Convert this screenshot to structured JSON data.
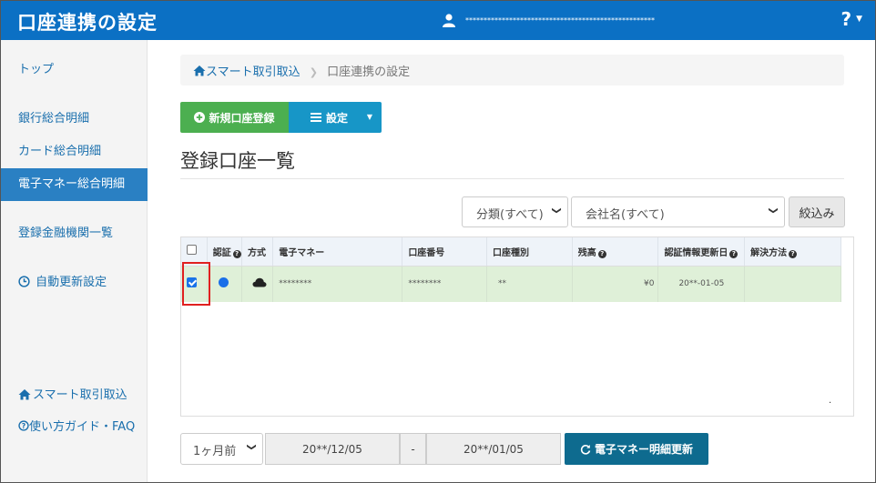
{
  "header": {
    "title": "口座連携の設定",
    "user_name": "****************************************************",
    "help_label": "?"
  },
  "sidebar": {
    "items": [
      {
        "label": "トップ"
      },
      {
        "label": "銀行総合明細"
      },
      {
        "label": "カード総合明細"
      },
      {
        "label": "電子マネー総合明細"
      },
      {
        "label": "登録金融機関一覧"
      },
      {
        "label": "自動更新設定"
      },
      {
        "label": "スマート取引取込"
      },
      {
        "label": "使い方ガイド・FAQ"
      }
    ]
  },
  "breadcrumb": {
    "home": "スマート取引取込",
    "current": "口座連携の設定"
  },
  "toolbar": {
    "new_label": "新規口座登録",
    "settings_label": "設定"
  },
  "section": {
    "title": "登録口座一覧"
  },
  "filters": {
    "category": "分類(すべて)",
    "company": "会社名(すべて)",
    "apply_label": "絞込み"
  },
  "table": {
    "headers": [
      "認証",
      "方式",
      "電子マネー",
      "口座番号",
      "口座種別",
      "残高",
      "認証情報更新日",
      "解決方法"
    ],
    "rows": [
      {
        "checked": true,
        "auth_status": "blue",
        "emoney": "********",
        "account_number": "********",
        "account_type": "**",
        "balance": "¥0",
        "updated": "20**-01-05",
        "solution": ""
      }
    ]
  },
  "bottom": {
    "period": "1ヶ月前",
    "date_from": "20**/12/05",
    "date_sep": "-",
    "date_to": "20**/01/05",
    "update_label": "電子マネー明細更新"
  }
}
